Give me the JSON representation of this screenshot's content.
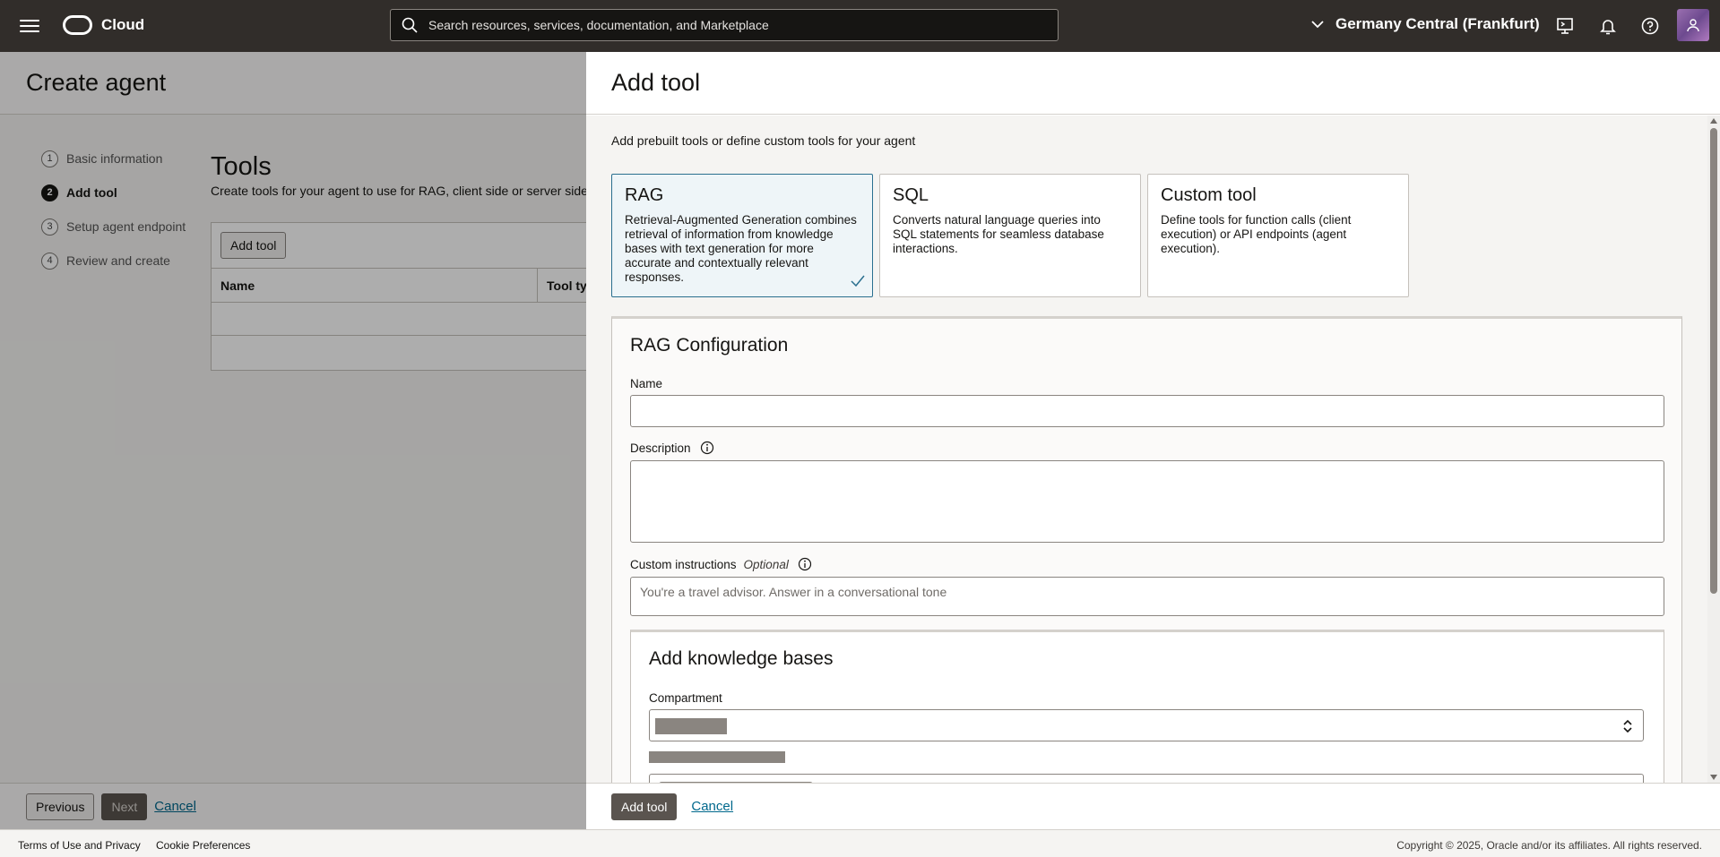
{
  "header": {
    "brand": "Cloud",
    "search_placeholder": "Search resources, services, documentation, and Marketplace",
    "region": "Germany Central (Frankfurt)"
  },
  "underlay": {
    "title": "Create agent",
    "steps": [
      {
        "num": "1",
        "label": "Basic information"
      },
      {
        "num": "2",
        "label": "Add tool"
      },
      {
        "num": "3",
        "label": "Setup agent endpoint"
      },
      {
        "num": "4",
        "label": "Review and create"
      }
    ],
    "tools_heading": "Tools",
    "tools_sub": "Create tools for your agent to use for RAG, client side or server side",
    "add_tool_label": "Add tool",
    "columns": [
      "Name",
      "Tool type"
    ],
    "footer": {
      "previous": "Previous",
      "next": "Next",
      "cancel": "Cancel"
    }
  },
  "panel": {
    "title": "Add tool",
    "intro": "Add prebuilt tools or define custom tools for your agent",
    "cards": [
      {
        "title": "RAG",
        "desc": "Retrieval-Augmented Generation combines retrieval of information from knowledge bases with text generation for more accurate and contextually relevant responses.",
        "selected": true
      },
      {
        "title": "SQL",
        "desc": "Converts natural language queries into SQL statements for seamless database interactions.",
        "selected": false
      },
      {
        "title": "Custom tool",
        "desc": "Define tools for function calls (client execution) or API endpoints (agent execution).",
        "selected": false
      }
    ],
    "config": {
      "title": "RAG Configuration",
      "name_label": "Name",
      "name_value": "",
      "description_label": "Description",
      "description_value": "",
      "instructions_label": "Custom instructions",
      "instructions_optional": "Optional",
      "instructions_placeholder": "You're a travel advisor. Answer in a conversational tone",
      "kb_title": "Add knowledge bases",
      "compartment_label": "Compartment"
    },
    "footer": {
      "add": "Add tool",
      "cancel": "Cancel"
    }
  },
  "pagefoot": {
    "terms": "Terms of Use and Privacy",
    "cookies": "Cookie Preferences",
    "copyright": "Copyright © 2025, Oracle and/or its affiliates. All rights reserved."
  }
}
